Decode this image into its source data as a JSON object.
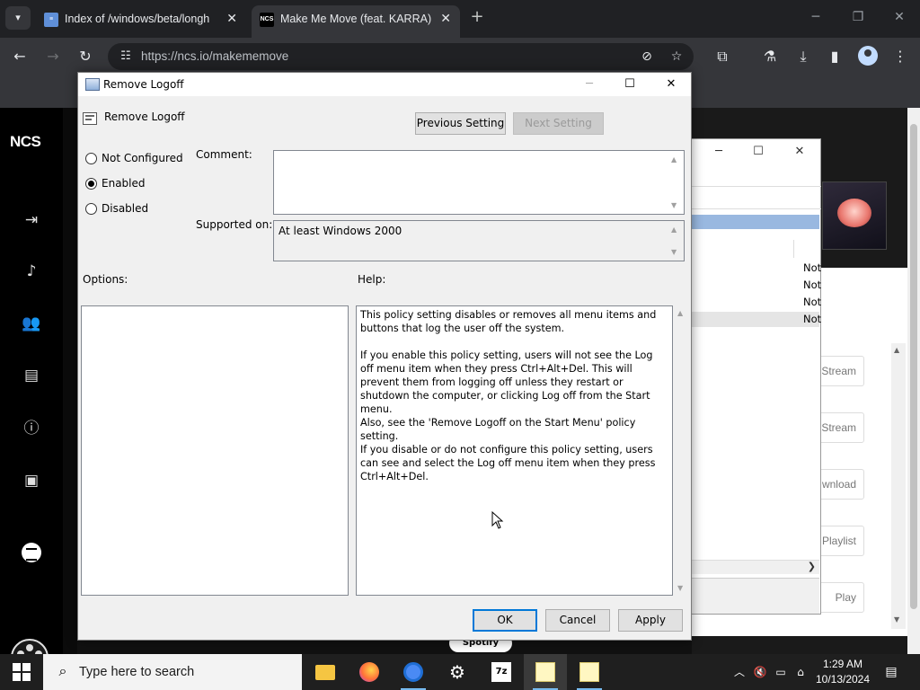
{
  "browser": {
    "tabs": [
      {
        "title": "Index of /windows/beta/longh",
        "icon": "file-icon",
        "active": false
      },
      {
        "title": "Make Me Move (feat. KARRA) |",
        "icon": "ncs-favicon",
        "active": true
      }
    ],
    "url": "https://ncs.io/makememove"
  },
  "ncs_page": {
    "logo": "NCS",
    "side_icons": [
      "login-icon",
      "music-note-icon",
      "people-icon",
      "document-icon",
      "info-icon",
      "contact-icon",
      "spotify-icon"
    ],
    "buttons": [
      "Stream",
      "Stream",
      "wnload",
      "Playlist",
      "Play"
    ],
    "spotify_label": "Spotify",
    "list_rows": [
      "Not",
      "Not",
      "Not",
      "Not"
    ]
  },
  "dialog": {
    "title": "Remove Logoff",
    "setting_name": "Remove Logoff",
    "previous_setting": "Previous Setting",
    "next_setting": "Next Setting",
    "radios": [
      {
        "label": "Not Configured",
        "checked": false
      },
      {
        "label": "Enabled",
        "checked": true
      },
      {
        "label": "Disabled",
        "checked": false
      }
    ],
    "comment_label": "Comment:",
    "comment_value": "",
    "supported_on_label": "Supported on:",
    "supported_on_value": "At least Windows 2000",
    "options_label": "Options:",
    "help_label": "Help:",
    "help_paragraphs": [
      "This policy setting disables or removes all menu items and buttons that log the user off the system.",
      "If you enable this policy setting, users will not see the Log off menu item when they press Ctrl+Alt+Del. This will prevent them from logging off unless they restart or shutdown the computer, or clicking Log off from the Start menu.",
      "Also, see the 'Remove Logoff on the Start Menu' policy setting.",
      "If you disable or do not configure this policy setting, users can see and select the Log off menu item when they press Ctrl+Alt+Del."
    ],
    "ok": "OK",
    "cancel": "Cancel",
    "apply": "Apply"
  },
  "taskbar": {
    "search_placeholder": "Type here to search",
    "apps": [
      "file-explorer-icon",
      "firefox-icon",
      "chrome-icon",
      "settings-icon",
      "7zip-icon",
      "notepad-icon",
      "notepad-icon"
    ],
    "time": "1:29 AM",
    "date": "10/13/2024"
  }
}
